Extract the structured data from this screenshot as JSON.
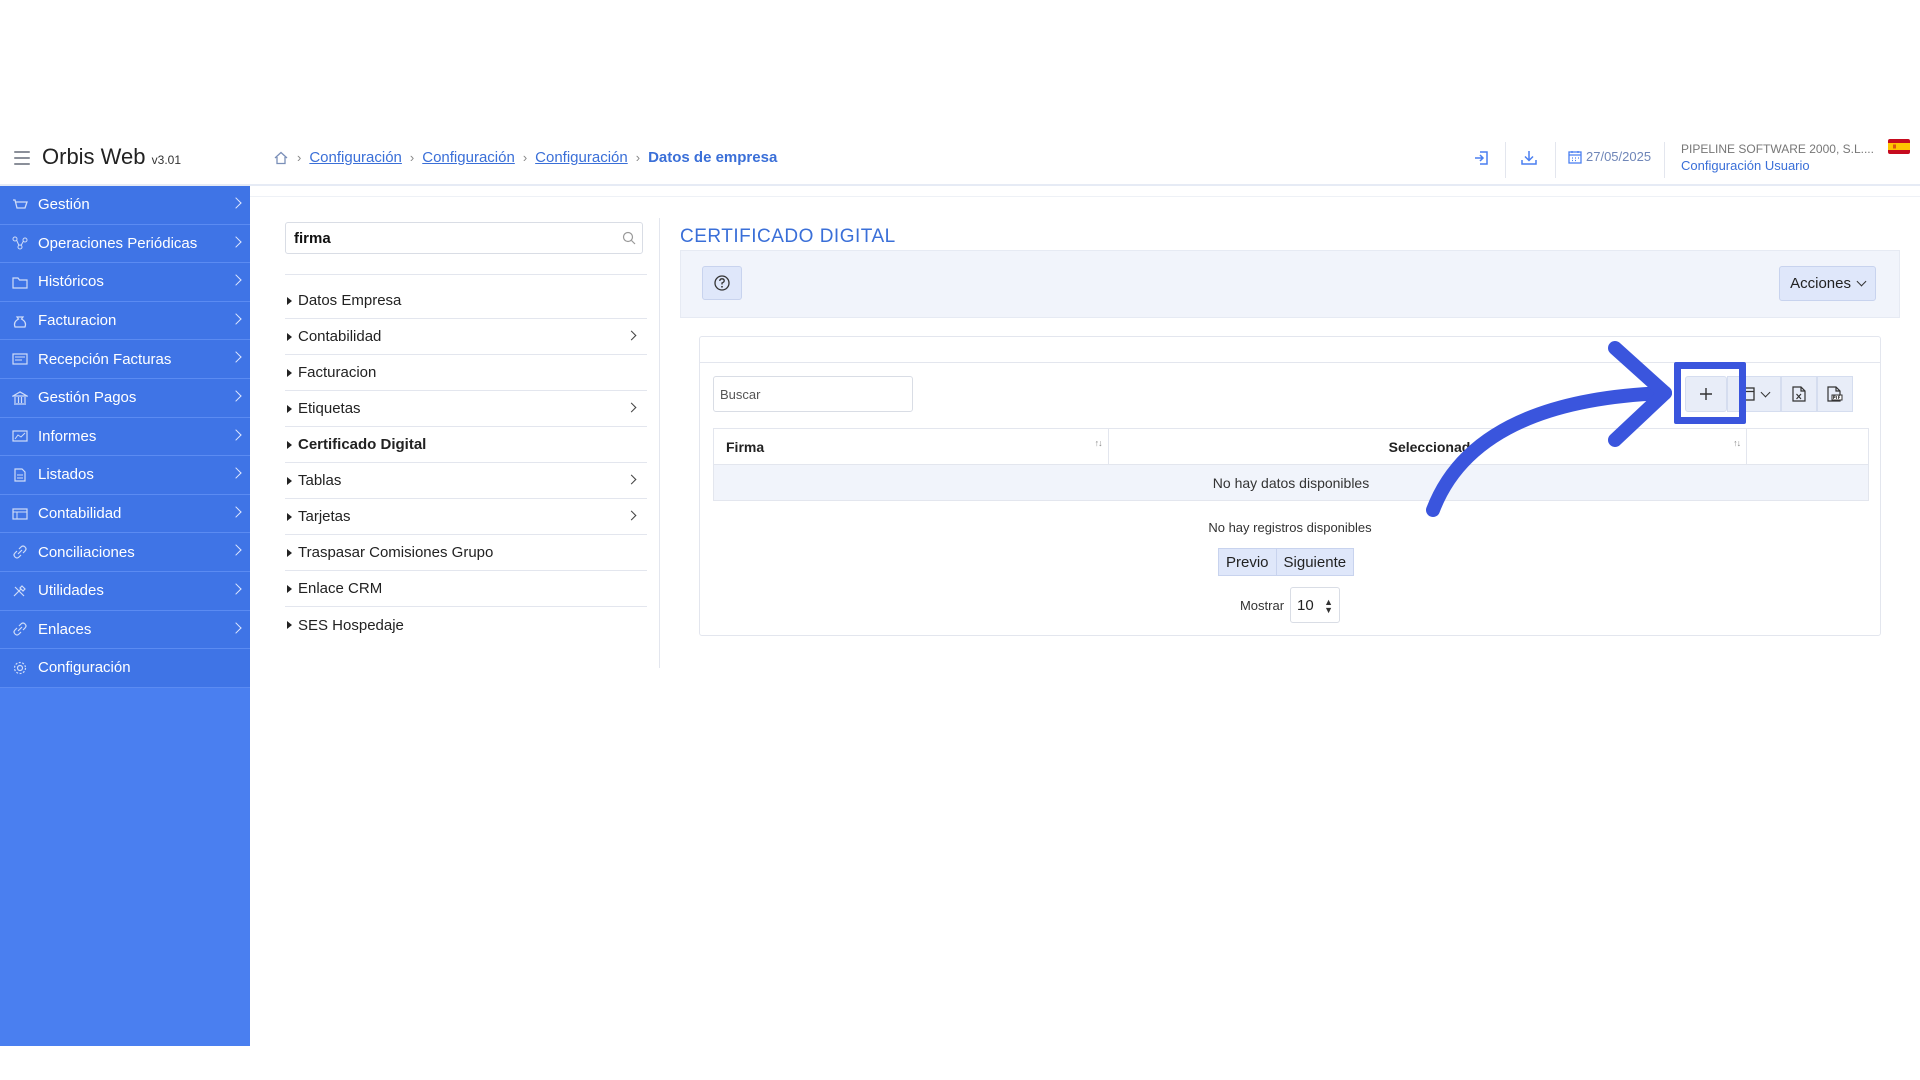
{
  "header": {
    "app_name": "Orbis Web",
    "version": "v3.01",
    "breadcrumbs": [
      "Configuración",
      "Configuración",
      "Configuración"
    ],
    "breadcrumb_current": "Datos de empresa",
    "date": "27/05/2025",
    "company": "PIPELINE SOFTWARE 2000, S.L....",
    "user_config_link": "Configuración Usuario"
  },
  "sidebar": {
    "items": [
      {
        "label": "Gestión",
        "icon": "cart-icon"
      },
      {
        "label": "Operaciones Periódicas",
        "icon": "network-icon"
      },
      {
        "label": "Históricos",
        "icon": "folder-icon"
      },
      {
        "label": "Facturacion",
        "icon": "money-bag-icon"
      },
      {
        "label": "Recepción Facturas",
        "icon": "invoice-icon"
      },
      {
        "label": "Gestión Pagos",
        "icon": "bank-icon"
      },
      {
        "label": "Informes",
        "icon": "report-icon"
      },
      {
        "label": "Listados",
        "icon": "document-icon"
      },
      {
        "label": "Contabilidad",
        "icon": "ledger-icon"
      },
      {
        "label": "Conciliaciones",
        "icon": "link-icon"
      },
      {
        "label": "Utilidades",
        "icon": "tools-icon"
      },
      {
        "label": "Enlaces",
        "icon": "link-icon"
      },
      {
        "label": "Configuración",
        "icon": "gear-icon"
      }
    ]
  },
  "tree": {
    "search_value": "firma",
    "items": [
      {
        "label": "Datos Empresa",
        "has_children": false,
        "active": false
      },
      {
        "label": "Contabilidad",
        "has_children": true,
        "active": false
      },
      {
        "label": "Facturacion",
        "has_children": false,
        "active": false
      },
      {
        "label": "Etiquetas",
        "has_children": true,
        "active": false
      },
      {
        "label": "Certificado Digital",
        "has_children": false,
        "active": true
      },
      {
        "label": "Tablas",
        "has_children": true,
        "active": false
      },
      {
        "label": "Tarjetas",
        "has_children": true,
        "active": false
      },
      {
        "label": "Traspasar Comisiones Grupo",
        "has_children": false,
        "active": false
      },
      {
        "label": "Enlace CRM",
        "has_children": false,
        "active": false
      },
      {
        "label": "SES Hospedaje",
        "has_children": false,
        "active": false
      }
    ]
  },
  "main": {
    "title": "CERTIFICADO DIGITAL",
    "actions_label": "Acciones",
    "grid": {
      "search_placeholder": "Buscar",
      "columns": [
        "Firma",
        "Seleccionada"
      ],
      "empty_text": "No hay datos disponibles",
      "no_records_text": "No hay registros disponibles",
      "prev_label": "Previo",
      "next_label": "Siguiente",
      "show_label": "Mostrar",
      "page_size": "10"
    }
  },
  "colors": {
    "accent": "#3a6fd8",
    "sidebar": "#4a7ff0",
    "annotation": "#3a55dd"
  }
}
